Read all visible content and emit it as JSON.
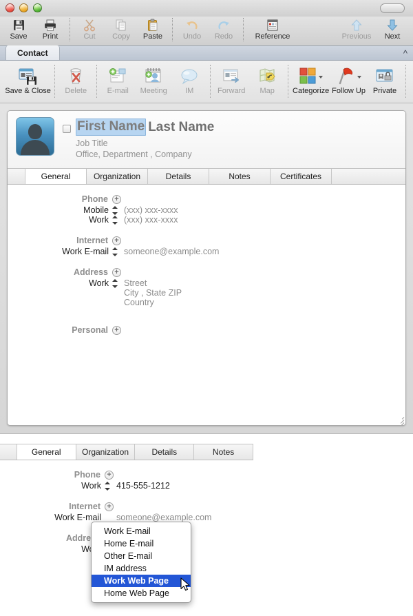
{
  "window": {
    "traffic_lights": [
      "close",
      "minimize",
      "zoom"
    ],
    "toolbar_toggle": "toolbar-toggle-pill"
  },
  "toolbar": {
    "items": [
      {
        "label": "Save",
        "icon": "floppy-disk-icon",
        "enabled": true
      },
      {
        "label": "Print",
        "icon": "printer-icon",
        "enabled": true
      },
      {
        "label": "Cut",
        "icon": "scissors-icon",
        "enabled": false
      },
      {
        "label": "Copy",
        "icon": "copy-pages-icon",
        "enabled": false
      },
      {
        "label": "Paste",
        "icon": "clipboard-icon",
        "enabled": true
      },
      {
        "label": "Undo",
        "icon": "undo-arrow-icon",
        "enabled": false
      },
      {
        "label": "Redo",
        "icon": "redo-arrow-icon",
        "enabled": false
      },
      {
        "label": "Reference",
        "icon": "reference-card-icon",
        "enabled": true
      }
    ],
    "nav": [
      {
        "label": "Previous",
        "icon": "arrow-up-icon",
        "enabled": false
      },
      {
        "label": "Next",
        "icon": "arrow-down-icon",
        "enabled": true
      }
    ]
  },
  "ribbon_tabbar": {
    "tabs": [
      "Contact"
    ],
    "active": "Contact",
    "collapse_icon": "chevron-up-icon"
  },
  "ribbon": {
    "items": [
      {
        "label": "Save & Close",
        "icon": "save-close-icon",
        "enabled": true,
        "caret": false
      },
      {
        "label": "Delete",
        "icon": "trash-delete-icon",
        "enabled": false,
        "caret": false
      },
      {
        "label": "E-mail",
        "icon": "new-email-icon",
        "enabled": false,
        "caret": false
      },
      {
        "label": "Meeting",
        "icon": "new-meeting-icon",
        "enabled": false,
        "caret": false
      },
      {
        "label": "IM",
        "icon": "chat-bubble-icon",
        "enabled": false,
        "caret": false
      },
      {
        "label": "Forward",
        "icon": "forward-card-icon",
        "enabled": false,
        "caret": false
      },
      {
        "label": "Map",
        "icon": "map-pin-icon",
        "enabled": false,
        "caret": false
      },
      {
        "label": "Categorize",
        "icon": "categorize-squares-icon",
        "enabled": true,
        "caret": true
      },
      {
        "label": "Follow Up",
        "icon": "red-flag-icon",
        "enabled": true,
        "caret": true
      },
      {
        "label": "Private",
        "icon": "private-lock-icon",
        "enabled": true,
        "caret": false
      }
    ]
  },
  "contact_card": {
    "avatar": "person-placeholder-avatar",
    "name_checkbox_checked": false,
    "first_name": "First Name",
    "first_name_selected": true,
    "last_name": "Last Name",
    "job_title": "Job Title",
    "org_line": "Office,  Department ,  Company",
    "tabs": [
      "General",
      "Organization",
      "Details",
      "Notes",
      "Certificates"
    ],
    "active_tab": "General",
    "sections": [
      {
        "title": "Phone",
        "add_icon": "plus-circle-icon",
        "rows": [
          {
            "label": "Mobile",
            "stepper": true,
            "value": "(xxx) xxx-xxxx",
            "filled": false
          },
          {
            "label": "Work",
            "stepper": true,
            "value": "(xxx) xxx-xxxx",
            "filled": false
          }
        ]
      },
      {
        "title": "Internet",
        "add_icon": "plus-circle-icon",
        "rows": [
          {
            "label": "Work E-mail",
            "stepper": true,
            "value": "someone@example.com",
            "filled": false
          }
        ]
      },
      {
        "title": "Address",
        "add_icon": "plus-circle-icon",
        "rows": [
          {
            "label": "Work",
            "stepper": true,
            "value": "Street",
            "filled": false
          },
          {
            "label": "",
            "stepper": false,
            "value": "City , State ZIP",
            "filled": false
          },
          {
            "label": "",
            "stepper": false,
            "value": "Country",
            "filled": false
          }
        ]
      },
      {
        "title": "Personal",
        "add_icon": "plus-circle-icon",
        "rows": []
      }
    ]
  },
  "panel2": {
    "tabs": [
      "General",
      "Organization",
      "Details",
      "Notes"
    ],
    "active_tab": "General",
    "sections": [
      {
        "title": "Phone",
        "add_icon": "plus-circle-icon",
        "rows": [
          {
            "label": "Work",
            "stepper": true,
            "value": "415-555-1212",
            "filled": true
          }
        ]
      },
      {
        "title": "Internet",
        "add_icon": "plus-circle-icon",
        "rows": [
          {
            "label": "Work E-mail",
            "stepper": false,
            "value": "someone@example.com",
            "filled": false
          }
        ]
      },
      {
        "title": "Address",
        "add_icon": "plus-circle-icon",
        "rows": [
          {
            "label": "Work",
            "stepper": false,
            "value": "",
            "filled": false
          }
        ]
      }
    ]
  },
  "dropdown_menu": {
    "items": [
      "Work E-mail",
      "Home E-mail",
      "Other E-mail",
      "IM address",
      "Work Web Page",
      "Home Web Page"
    ],
    "selected": "Work Web Page",
    "selected_index": 4,
    "highlight_color": "#2356d6",
    "cursor": "arrow-pointer"
  }
}
